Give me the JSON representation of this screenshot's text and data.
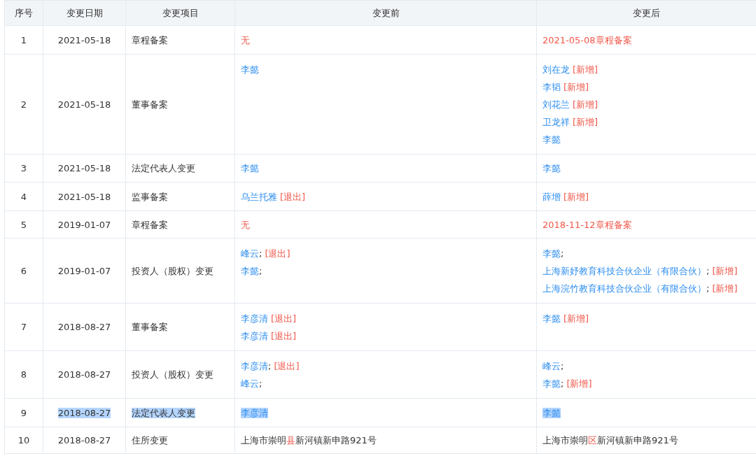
{
  "table": {
    "columns": [
      "序号",
      "变更日期",
      "变更项目",
      "变更前",
      "变更后"
    ],
    "rows": [
      {
        "index": "1",
        "date": "2021-05-18",
        "item": "章程备案",
        "highlighted": false,
        "before": [
          {
            "kind": "text",
            "segments": [
              {
                "kind": "diff",
                "text": "无"
              }
            ]
          }
        ],
        "after": [
          {
            "kind": "text",
            "segments": [
              {
                "kind": "diff",
                "text": "2021-05-08章程备案"
              }
            ]
          }
        ]
      },
      {
        "index": "2",
        "date": "2021-05-18",
        "item": "董事备案",
        "highlighted": false,
        "before": [
          {
            "kind": "parts",
            "segments": [
              {
                "kind": "name",
                "text": "李懿"
              }
            ]
          }
        ],
        "after": [
          {
            "kind": "parts",
            "segments": [
              {
                "kind": "name",
                "text": "刘在龙"
              },
              {
                "kind": "tag",
                "text": "[新增]"
              }
            ]
          },
          {
            "kind": "parts",
            "segments": [
              {
                "kind": "name",
                "text": "李韬"
              },
              {
                "kind": "tag",
                "text": "[新增]"
              }
            ]
          },
          {
            "kind": "parts",
            "segments": [
              {
                "kind": "name",
                "text": "刘花兰"
              },
              {
                "kind": "tag",
                "text": "[新增]"
              }
            ]
          },
          {
            "kind": "parts",
            "segments": [
              {
                "kind": "name",
                "text": "卫龙祥"
              },
              {
                "kind": "tag",
                "text": "[新增]"
              }
            ]
          },
          {
            "kind": "parts",
            "segments": [
              {
                "kind": "name",
                "text": "李懿"
              }
            ]
          }
        ]
      },
      {
        "index": "3",
        "date": "2021-05-18",
        "item": "法定代表人变更",
        "highlighted": false,
        "before": [
          {
            "kind": "parts",
            "segments": [
              {
                "kind": "name",
                "text": "李懿"
              }
            ]
          }
        ],
        "after": [
          {
            "kind": "parts",
            "segments": [
              {
                "kind": "name",
                "text": "李懿"
              }
            ]
          }
        ]
      },
      {
        "index": "4",
        "date": "2021-05-18",
        "item": "监事备案",
        "highlighted": false,
        "before": [
          {
            "kind": "parts",
            "segments": [
              {
                "kind": "name",
                "text": "乌兰托雅"
              },
              {
                "kind": "tag",
                "text": "[退出]"
              }
            ]
          }
        ],
        "after": [
          {
            "kind": "parts",
            "segments": [
              {
                "kind": "name",
                "text": "薛增"
              },
              {
                "kind": "tag",
                "text": "[新增]"
              }
            ]
          }
        ]
      },
      {
        "index": "5",
        "date": "2019-01-07",
        "item": "章程备案",
        "highlighted": false,
        "before": [
          {
            "kind": "text",
            "segments": [
              {
                "kind": "diff",
                "text": "无"
              }
            ]
          }
        ],
        "after": [
          {
            "kind": "text",
            "segments": [
              {
                "kind": "diff",
                "text": "2018-11-12章程备案"
              }
            ]
          }
        ]
      },
      {
        "index": "6",
        "date": "2019-01-07",
        "item": "投资人（股权）变更",
        "highlighted": false,
        "before": [
          {
            "kind": "parts",
            "segments": [
              {
                "kind": "name",
                "text": "峰云"
              },
              {
                "kind": "punct",
                "text": ";"
              },
              {
                "kind": "tag",
                "text": "[退出]"
              }
            ]
          },
          {
            "kind": "parts",
            "segments": [
              {
                "kind": "name",
                "text": "李懿"
              },
              {
                "kind": "punct",
                "text": ";"
              }
            ]
          }
        ],
        "after": [
          {
            "kind": "parts",
            "segments": [
              {
                "kind": "name",
                "text": "李懿"
              },
              {
                "kind": "punct",
                "text": ";"
              }
            ]
          },
          {
            "kind": "parts",
            "segments": [
              {
                "kind": "name",
                "text": "上海新妤教育科技合伙企业（有限合伙）"
              },
              {
                "kind": "punct",
                "text": ";"
              },
              {
                "kind": "tag",
                "text": "[新增]"
              }
            ]
          },
          {
            "kind": "parts",
            "segments": [
              {
                "kind": "name",
                "text": "上海浣竹教育科技合伙企业（有限合伙）"
              },
              {
                "kind": "punct",
                "text": ";"
              },
              {
                "kind": "tag",
                "text": "[新增]"
              }
            ]
          }
        ]
      },
      {
        "index": "7",
        "date": "2018-08-27",
        "item": "董事备案",
        "highlighted": false,
        "before": [
          {
            "kind": "parts",
            "segments": [
              {
                "kind": "name",
                "text": "李彦清"
              },
              {
                "kind": "tag",
                "text": "[退出]"
              }
            ]
          },
          {
            "kind": "parts",
            "segments": [
              {
                "kind": "name",
                "text": "李彦清"
              },
              {
                "kind": "tag",
                "text": "[退出]"
              }
            ]
          }
        ],
        "after": [
          {
            "kind": "parts",
            "segments": [
              {
                "kind": "name",
                "text": "李懿"
              },
              {
                "kind": "tag",
                "text": "[新增]"
              }
            ]
          }
        ]
      },
      {
        "index": "8",
        "date": "2018-08-27",
        "item": "投资人（股权）变更",
        "highlighted": false,
        "before": [
          {
            "kind": "parts",
            "segments": [
              {
                "kind": "name",
                "text": "李彦清"
              },
              {
                "kind": "punct",
                "text": ";"
              },
              {
                "kind": "tag",
                "text": "[退出]"
              }
            ]
          },
          {
            "kind": "parts",
            "segments": [
              {
                "kind": "name",
                "text": "峰云"
              },
              {
                "kind": "punct",
                "text": ";"
              }
            ]
          }
        ],
        "after": [
          {
            "kind": "parts",
            "segments": [
              {
                "kind": "name",
                "text": "峰云"
              },
              {
                "kind": "punct",
                "text": ";"
              }
            ]
          },
          {
            "kind": "parts",
            "segments": [
              {
                "kind": "name",
                "text": "李懿"
              },
              {
                "kind": "punct",
                "text": ";"
              },
              {
                "kind": "tag",
                "text": "[新增]"
              }
            ]
          }
        ]
      },
      {
        "index": "9",
        "date": "2018-08-27",
        "item": "法定代表人变更",
        "highlighted": true,
        "before": [
          {
            "kind": "parts",
            "segments": [
              {
                "kind": "name",
                "text": "李彦清"
              }
            ]
          }
        ],
        "after": [
          {
            "kind": "parts",
            "segments": [
              {
                "kind": "name",
                "text": "李懿"
              }
            ]
          }
        ]
      },
      {
        "index": "10",
        "date": "2018-08-27",
        "item": "住所变更",
        "highlighted": false,
        "before": [
          {
            "kind": "text",
            "segments": [
              {
                "kind": "plain",
                "text": "上海市崇明"
              },
              {
                "kind": "diff",
                "text": "县"
              },
              {
                "kind": "plain",
                "text": "新河镇新申路921号"
              }
            ]
          }
        ],
        "after": [
          {
            "kind": "text",
            "segments": [
              {
                "kind": "plain",
                "text": "上海市崇明"
              },
              {
                "kind": "diff",
                "text": "区"
              },
              {
                "kind": "plain",
                "text": "新河镇新申路921号"
              }
            ]
          }
        ]
      }
    ]
  }
}
